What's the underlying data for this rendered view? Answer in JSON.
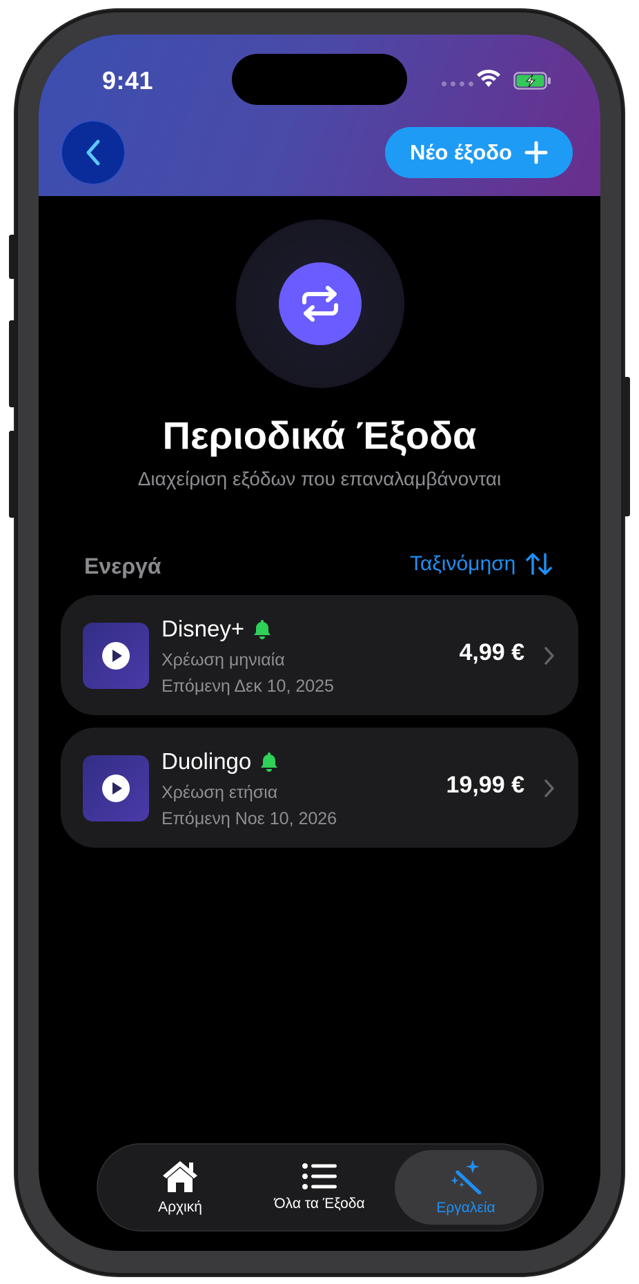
{
  "status_bar": {
    "time": "9:41"
  },
  "header": {
    "back_icon": "chevron-left-icon",
    "new_expense_label": "Νέο έξοδο",
    "new_expense_icon": "plus-icon"
  },
  "hero": {
    "icon": "repeat-icon",
    "title": "Περιοδικά Έξοδα",
    "subtitle": "Διαχείριση εξόδων που επαναλαμβάνονται"
  },
  "section": {
    "label": "Ενεργά",
    "sort_label": "Ταξινόμηση",
    "sort_icon": "sort-arrows-icon"
  },
  "expenses": [
    {
      "name": "Disney+",
      "billing": "Χρέωση μηνιαία",
      "next": "Επόμενη Δεκ 10, 2025",
      "amount": "4,99 €",
      "icon": "play-icon",
      "reminder_icon": "bell-icon"
    },
    {
      "name": "Duolingo",
      "billing": "Χρέωση ετήσια",
      "next": "Επόμενη Νοε 10, 2026",
      "amount": "19,99 €",
      "icon": "play-icon",
      "reminder_icon": "bell-icon"
    }
  ],
  "tabbar": {
    "items": [
      {
        "label": "Αρχική",
        "icon": "house-icon"
      },
      {
        "label": "Όλα τα Έξοδα",
        "icon": "list-icon"
      },
      {
        "label": "Εργαλεία",
        "icon": "magic-wand-icon"
      }
    ],
    "active_index": 2
  },
  "colors": {
    "accent": "#1e8ff5",
    "hero": "#6a5cff",
    "reminder": "#30d158"
  }
}
